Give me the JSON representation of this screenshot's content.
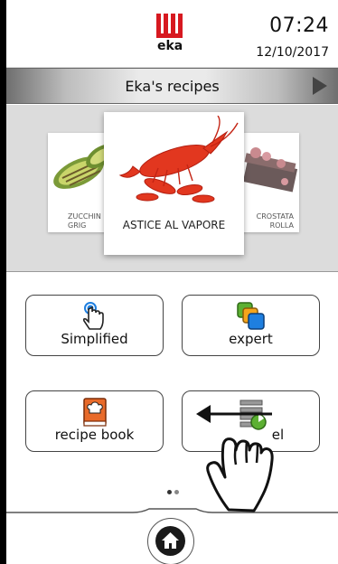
{
  "header": {
    "logo_text": "eka",
    "time": "07:24",
    "date": "12/10/2017"
  },
  "titlebar": {
    "title": "Eka's recipes"
  },
  "carousel": {
    "cards": [
      {
        "label_line1": "ZUCCHIN",
        "label_line2": "GRIG"
      },
      {
        "label": "ASTICE AL VAPORE"
      },
      {
        "label_line1": "CROSTATA",
        "label_line2": "ROLLA"
      }
    ]
  },
  "menu": {
    "simplified_label": "Simplified",
    "expert_label": "expert",
    "recipe_book_label": "recipe book",
    "multilevel_label": "el"
  },
  "pager": {
    "current": 1,
    "total": 2
  },
  "colors": {
    "brand_red": "#d71920",
    "accent_blue": "#1e7fe0",
    "accent_green": "#5cb032",
    "accent_orange": "#e86a2a"
  }
}
